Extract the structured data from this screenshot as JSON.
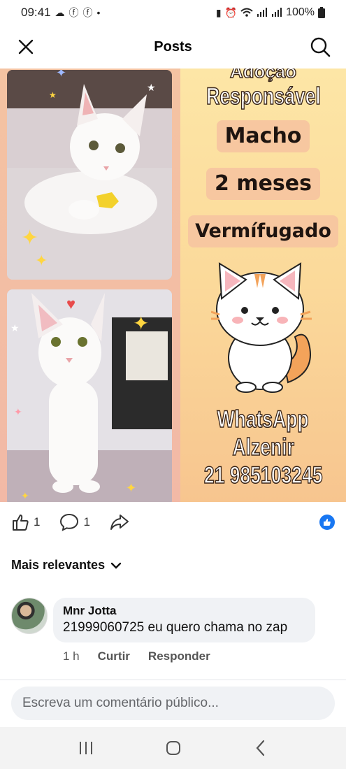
{
  "status": {
    "time": "09:41",
    "battery": "100%"
  },
  "header": {
    "title": "Posts"
  },
  "post": {
    "image_text": {
      "line1": "Adoção",
      "line2": "Responsável",
      "tag1": "Macho",
      "tag2": "2 meses",
      "tag3": "Vermífugado",
      "contact1": "WhatsApp",
      "contact2": "Alzenir",
      "contact3": "21 985103245"
    }
  },
  "actions": {
    "like_count": "1",
    "comment_count": "1"
  },
  "comments": {
    "sort_label": "Mais relevantes",
    "items": [
      {
        "author": "Mnr Jotta",
        "text": "21999060725 eu quero chama no zap",
        "time": "1 h",
        "like_label": "Curtir",
        "reply_label": "Responder"
      }
    ]
  },
  "composer": {
    "placeholder": "Escreva um comentário público..."
  },
  "colors": {
    "facebook_blue": "#1877f2",
    "bubble_bg": "#f0f2f5"
  }
}
